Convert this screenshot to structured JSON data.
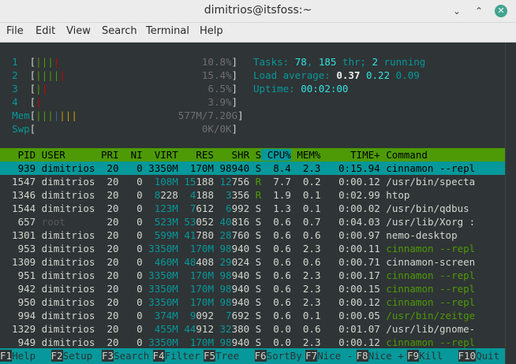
{
  "window": {
    "title": "dimitrios@itsfoss:~",
    "controls": {
      "minimize": "⌄",
      "maximize": "⌃",
      "close": "✕"
    }
  },
  "menubar": {
    "items": [
      "File",
      "Edit",
      "View",
      "Search",
      "Terminal",
      "Help"
    ]
  },
  "meters": [
    {
      "label": "1",
      "value": "10.8%"
    },
    {
      "label": "2",
      "value": "15.4%"
    },
    {
      "label": "3",
      "value": "6.5%"
    },
    {
      "label": "4",
      "value": "3.9%"
    },
    {
      "label": "Mem",
      "value": "577M/7.20G"
    },
    {
      "label": "Swp",
      "value": "0K/0K"
    }
  ],
  "stats": {
    "tasks_label": "Tasks: ",
    "tasks": "78",
    "threads": "185",
    "threads_suffix": " thr; ",
    "running": "2",
    "running_suffix": " running",
    "load_label": "Load average: ",
    "load1": "0.37",
    "load5": "0.22",
    "load15": "0.09",
    "uptime_label": "Uptime: ",
    "uptime": "00:02:00"
  },
  "table": {
    "columns": [
      "PID",
      "USER",
      "PRI",
      "NI",
      "VIRT",
      "RES",
      "SHR",
      "S",
      "CPU%",
      "MEM%",
      "TIME+",
      "Command"
    ],
    "rows": [
      [
        "939",
        "dimitrios",
        "20",
        "0",
        "3350M",
        "170M",
        "98940",
        "S",
        "8.4",
        "2.3",
        "0:15.94",
        "cinnamon --repl"
      ],
      [
        "1547",
        "dimitrios",
        "20",
        "0",
        "108M",
        "15188",
        "12756",
        "R",
        "7.7",
        "0.2",
        "0:00.12",
        "/usr/bin/specta"
      ],
      [
        "1346",
        "dimitrios",
        "20",
        "0",
        "8228",
        "4188",
        "3356",
        "R",
        "1.9",
        "0.1",
        "0:02.99",
        "htop"
      ],
      [
        "1544",
        "dimitrios",
        "20",
        "0",
        "123M",
        "7612",
        "6992",
        "S",
        "1.3",
        "0.1",
        "0:00.02",
        "/usr/bin/qdbus"
      ],
      [
        "657",
        "root",
        "20",
        "0",
        "523M",
        "53052",
        "40816",
        "S",
        "0.6",
        "0.7",
        "0:04.03",
        "/usr/lib/Xorg :"
      ],
      [
        "1301",
        "dimitrios",
        "20",
        "0",
        "599M",
        "41780",
        "28760",
        "S",
        "0.6",
        "0.6",
        "0:00.97",
        "nemo-desktop"
      ],
      [
        "953",
        "dimitrios",
        "20",
        "0",
        "3350M",
        "170M",
        "98940",
        "S",
        "0.6",
        "2.3",
        "0:00.11",
        "cinnamon --repl"
      ],
      [
        "1309",
        "dimitrios",
        "20",
        "0",
        "460M",
        "48408",
        "29024",
        "S",
        "0.6",
        "0.6",
        "0:00.71",
        "cinnamon-screen"
      ],
      [
        "951",
        "dimitrios",
        "20",
        "0",
        "3350M",
        "170M",
        "98940",
        "S",
        "0.6",
        "2.3",
        "0:00.17",
        "cinnamon --repl"
      ],
      [
        "942",
        "dimitrios",
        "20",
        "0",
        "3350M",
        "170M",
        "98940",
        "S",
        "0.6",
        "2.3",
        "0:00.15",
        "cinnamon --repl"
      ],
      [
        "950",
        "dimitrios",
        "20",
        "0",
        "3350M",
        "170M",
        "98940",
        "S",
        "0.6",
        "2.3",
        "0:00.12",
        "cinnamon --repl"
      ],
      [
        "994",
        "dimitrios",
        "20",
        "0",
        "374M",
        "9092",
        "7692",
        "S",
        "0.6",
        "0.1",
        "0:00.05",
        "/usr/bin/zeitge"
      ],
      [
        "1329",
        "dimitrios",
        "20",
        "0",
        "455M",
        "44912",
        "32380",
        "S",
        "0.0",
        "0.6",
        "0:01.07",
        "/usr/lib/gnome-"
      ],
      [
        "949",
        "dimitrios",
        "20",
        "0",
        "3350M",
        "170M",
        "98940",
        "S",
        "0.0",
        "2.3",
        "0:00.12",
        "cinnamon --repl"
      ]
    ]
  },
  "footer": [
    {
      "key": "F1",
      "label": "Help"
    },
    {
      "key": "F2",
      "label": "Setup"
    },
    {
      "key": "F3",
      "label": "Search"
    },
    {
      "key": "F4",
      "label": "Filter"
    },
    {
      "key": "F5",
      "label": "Tree"
    },
    {
      "key": "F6",
      "label": "SortBy"
    },
    {
      "key": "F7",
      "label": "Nice -"
    },
    {
      "key": "F8",
      "label": "Nice +"
    },
    {
      "key": "F9",
      "label": "Kill"
    },
    {
      "key": "F10",
      "label": "Quit"
    }
  ],
  "colors": {
    "header_green": "#4e9a06",
    "highlight_cyan": "#06989a",
    "terminal_bg": "#2f3436"
  }
}
